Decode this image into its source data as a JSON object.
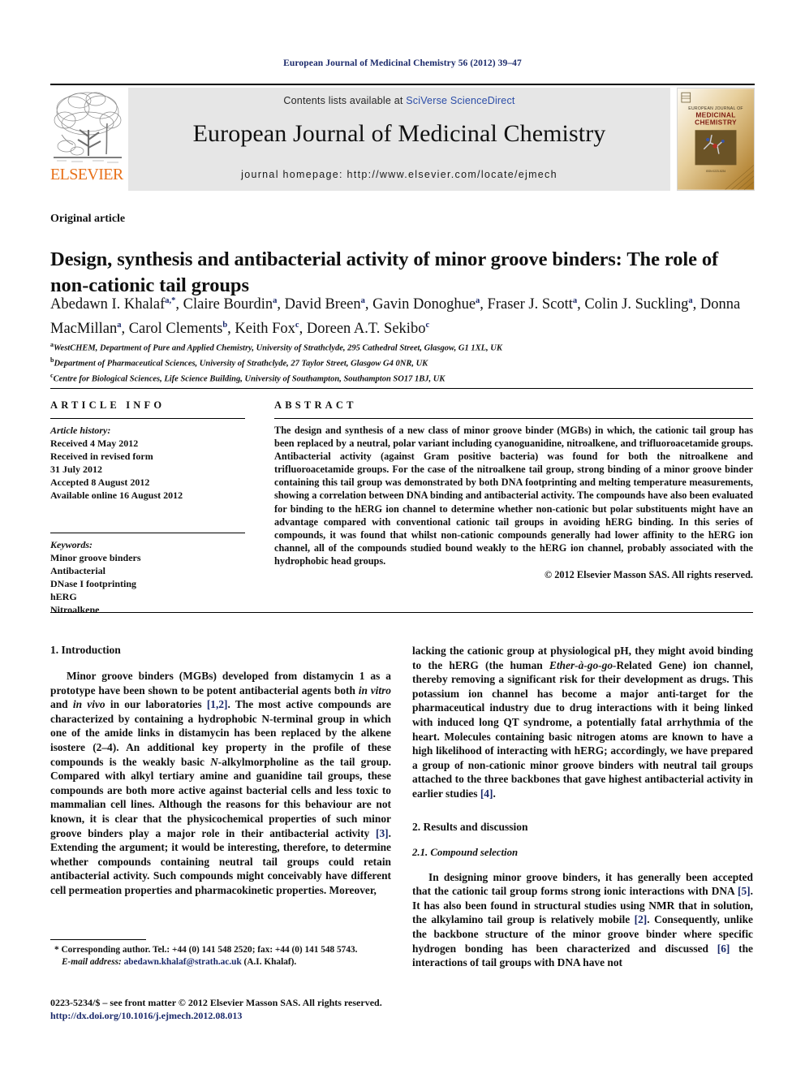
{
  "running_head": "European Journal of Medicinal Chemistry 56 (2012) 39–47",
  "banner": {
    "contents_prefix": "Contents lists available at ",
    "sciencedirect_link": "SciVerse ScienceDirect",
    "journal_title": "European Journal of Medicinal Chemistry",
    "homepage_label": "journal homepage: http://www.elsevier.com/locate/ejmech",
    "publisher_name": "ELSEVIER",
    "cover_title_line1": "EUROPEAN JOURNAL OF",
    "cover_title_line2": "MEDICINAL",
    "cover_title_line3": "CHEMISTRY"
  },
  "article_type": "Original article",
  "title": "Design, synthesis and antibacterial activity of minor groove binders: The role of non-cationic tail groups",
  "authors_line1": "Abedawn I. Khalaf",
  "authors": [
    {
      "name": "Abedawn I. Khalaf",
      "sup": "a,*"
    },
    {
      "name": "Claire Bourdin",
      "sup": "a"
    },
    {
      "name": "David Breen",
      "sup": "a"
    },
    {
      "name": "Gavin Donoghue",
      "sup": "a"
    },
    {
      "name": "Fraser J. Scott",
      "sup": "a"
    },
    {
      "name": "Colin J. Suckling",
      "sup": "a"
    },
    {
      "name": "Donna MacMillan",
      "sup": "a"
    },
    {
      "name": "Carol Clements",
      "sup": "b"
    },
    {
      "name": "Keith Fox",
      "sup": "c"
    },
    {
      "name": "Doreen A.T. Sekibo",
      "sup": "c"
    }
  ],
  "affiliations": [
    {
      "mark": "a",
      "text": "WestCHEM, Department of Pure and Applied Chemistry, University of Strathclyde, 295 Cathedral Street, Glasgow, G1 1XL, UK"
    },
    {
      "mark": "b",
      "text": "Department of Pharmaceutical Sciences, University of Strathclyde, 27 Taylor Street, Glasgow G4 0NR, UK"
    },
    {
      "mark": "c",
      "text": "Centre for Biological Sciences, Life Science Building, University of Southampton, Southampton SO17 1BJ, UK"
    }
  ],
  "article_info": {
    "heading": "ARTICLE INFO",
    "history_label": "Article history:",
    "history": [
      "Received 4 May 2012",
      "Received in revised form",
      "31 July 2012",
      "Accepted 8 August 2012",
      "Available online 16 August 2012"
    ],
    "keywords_label": "Keywords:",
    "keywords": [
      "Minor groove binders",
      "Antibacterial",
      "DNase I footprinting",
      "hERG",
      "Nitroalkene"
    ]
  },
  "abstract": {
    "heading": "ABSTRACT",
    "body": "The design and synthesis of a new class of minor groove binder (MGBs) in which, the cationic tail group has been replaced by a neutral, polar variant including cyanoguanidine, nitroalkene, and trifluoroacetamide groups. Antibacterial activity (against Gram positive bacteria) was found for both the nitroalkene and trifluoroacetamide groups. For the case of the nitroalkene tail group, strong binding of a minor groove binder containing this tail group was demonstrated by both DNA footprinting and melting temperature measurements, showing a correlation between DNA binding and antibacterial activity. The compounds have also been evaluated for binding to the hERG ion channel to determine whether non-cationic but polar substituents might have an advantage compared with conventional cationic tail groups in avoiding hERG binding. In this series of compounds, it was found that whilst non-cationic compounds generally had lower affinity to the hERG ion channel, all of the compounds studied bound weakly to the hERG ion channel, probably associated with the hydrophobic head groups.",
    "copyright": "© 2012 Elsevier Masson SAS. All rights reserved."
  },
  "sections": {
    "intro_heading": "1. Introduction",
    "results_heading": "2. Results and discussion",
    "compound_selection_heading": "2.1. Compound selection"
  },
  "body": {
    "intro_p1_a": "Minor groove binders (MGBs) developed from distamycin 1 as a prototype have been shown to be potent antibacterial agents both ",
    "intro_p1_invitro": "in vitro",
    "intro_p1_b": " and ",
    "intro_p1_invivo": "in vivo",
    "intro_p1_c": " in our laboratories ",
    "intro_p1_ref1": "[1,2]",
    "intro_p1_d": ". The most active compounds are characterized by containing a hydrophobic N-terminal group in which one of the amide links in distamycin has been replaced by the alkene isostere (2–4). An additional key property in the profile of these compounds is the weakly basic ",
    "intro_p1_nalkyl": "N-",
    "intro_p1_e": "alkylmorpholine as the tail group. Compared with alkyl tertiary amine and guanidine tail groups, these compounds are both more active against bacterial cells and less toxic to mammalian cell lines. Although the reasons for this behaviour are not known, it is clear that the physicochemical properties of such minor groove binders play a major role in their antibacterial activity ",
    "intro_p1_ref3": "[3]",
    "intro_p1_f": ". Extending the argument; it would be interesting, therefore, to determine whether compounds containing neutral tail groups could retain antibacterial activity. Such compounds might conceivably have different cell permeation properties and pharmacokinetic properties. Moreover,",
    "right_p1_a": "lacking the cationic group at physiological pH, they might avoid binding to the hERG (the human ",
    "right_p1_ether": "Ether-à-go-go-",
    "right_p1_b": "Related Gene) ion channel, thereby removing a significant risk for their development as drugs. This potassium ion channel has become a major anti-target for the pharmaceutical industry due to drug interactions with it being linked with induced long QT syndrome, a potentially fatal arrhythmia of the heart. Molecules containing basic nitrogen atoms are known to have a high likelihood of interacting with hERG; accordingly, we have prepared a group of non-cationic minor groove binders with neutral tail groups attached to the three backbones that gave highest antibacterial activity in earlier studies ",
    "right_p1_ref4": "[4]",
    "right_p1_c": ".",
    "right_p2_a": "In designing minor groove binders, it has generally been accepted that the cationic tail group forms strong ionic interactions with DNA ",
    "right_p2_ref5": "[5]",
    "right_p2_b": ". It has also been found in structural studies using NMR that in solution, the alkylamino tail group is relatively mobile ",
    "right_p2_ref2": "[2]",
    "right_p2_c": ". Consequently, unlike the backbone structure of the minor groove binder where specific hydrogen bonding has been characterized and discussed ",
    "right_p2_ref6": "[6]",
    "right_p2_d": " the interactions of tail groups with DNA have not"
  },
  "footnote": {
    "line1": "* Corresponding author. Tel.: +44 (0) 141 548 2520; fax: +44 (0) 141 548 5743.",
    "email_label": "E-mail address:",
    "email": "abedawn.khalaf@strath.ac.uk",
    "email_suffix": " (A.I. Khalaf)."
  },
  "bottom_matter": {
    "front_matter": "0223-5234/$ – see front matter © 2012 Elsevier Masson SAS. All rights reserved.",
    "doi": "http://dx.doi.org/10.1016/j.ejmech.2012.08.013"
  },
  "colors": {
    "link": "#1b2a6b",
    "sciencedirect": "#2c4ea8",
    "elsevier_orange": "#e8711a",
    "banner_grey": "#e6e6e6"
  }
}
